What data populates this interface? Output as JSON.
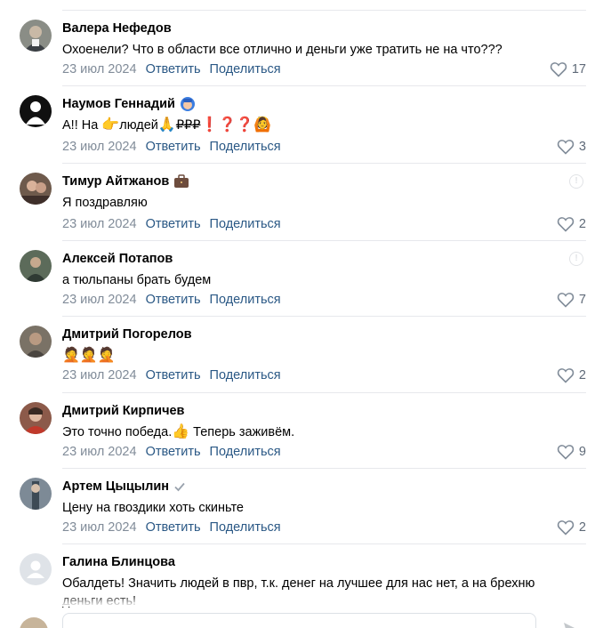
{
  "comments": [
    {
      "author": "Валера Нефедов",
      "text": "Охоенели? Что в области все отлично и деньги уже тратить не на что???",
      "date": "23 июл 2024",
      "reply": "Ответить",
      "share": "Поделиться",
      "likes": "17"
    },
    {
      "author": "Наумов Геннадий",
      "text_parts": [
        "А!! На ",
        "👉",
        "людей",
        "🙏",
        "₽₽₽",
        "❗❓❓",
        "🙆"
      ],
      "date": "23 июл 2024",
      "reply": "Ответить",
      "share": "Поделиться",
      "likes": "3"
    },
    {
      "author": "Тимур Айтжанов",
      "text": "Я поздравляю",
      "date": "23 июл 2024",
      "reply": "Ответить",
      "share": "Поделиться",
      "likes": "2"
    },
    {
      "author": "Алексей Потапов",
      "text": "а тюльпаны брать будем",
      "date": "23 июл 2024",
      "reply": "Ответить",
      "share": "Поделиться",
      "likes": "7"
    },
    {
      "author": "Дмитрий Погорелов",
      "text": "🤦🤦🤦",
      "date": "23 июл 2024",
      "reply": "Ответить",
      "share": "Поделиться",
      "likes": "2"
    },
    {
      "author": "Дмитрий Кирпичев",
      "text_before": "Это точно победа.",
      "text_emoji": "👍",
      "text_after": " Теперь заживём.",
      "date": "23 июл 2024",
      "reply": "Ответить",
      "share": "Поделиться",
      "likes": "9"
    },
    {
      "author": "Артем Цыцылин",
      "text": "Цену на гвоздики хоть скиньте",
      "date": "23 июл 2024",
      "reply": "Ответить",
      "share": "Поделиться",
      "likes": "2"
    },
    {
      "author": "Галина Блинцова",
      "text": "Обалдеть! Значить людей в пвр, т.к. денег на лучшее для нас нет, а на брехню деньги есть!"
    }
  ],
  "colors": {
    "link": "#2a5885",
    "meta": "#818c99",
    "divider": "#e7e8ec"
  }
}
